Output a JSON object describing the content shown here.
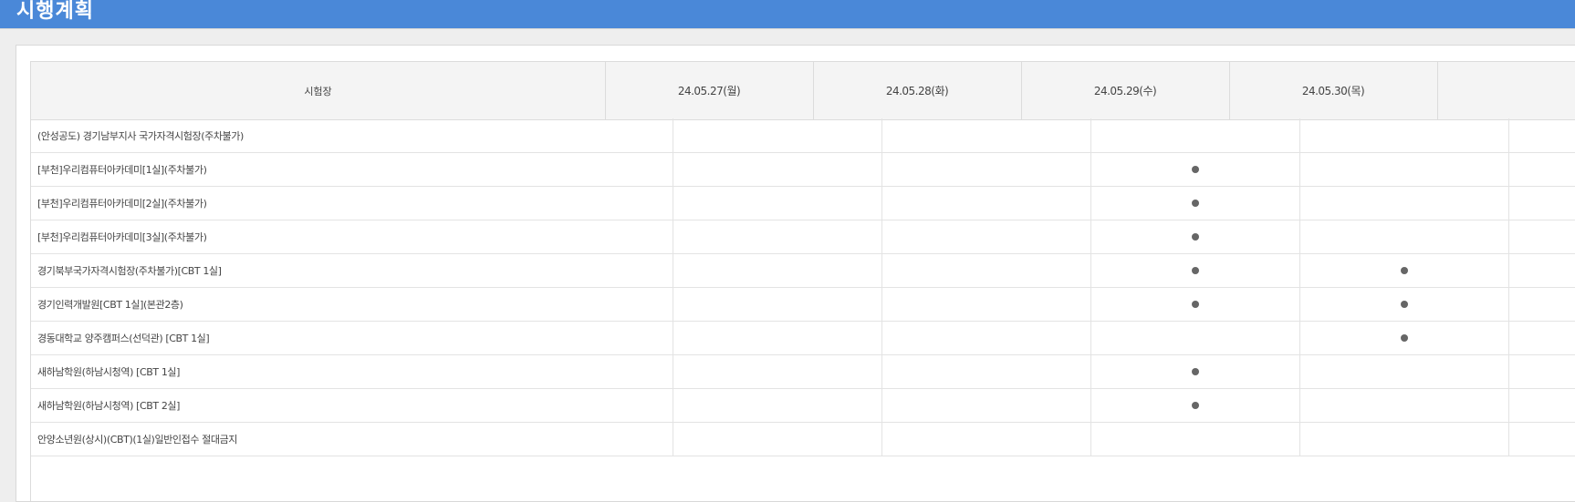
{
  "page": {
    "title": "시행계획"
  },
  "table": {
    "header": {
      "site_label": "시험장",
      "dates": [
        "24.05.27(월)",
        "24.05.28(화)",
        "24.05.29(수)",
        "24.05.30(목)"
      ]
    },
    "rows": [
      {
        "name": "(안성공도) 경기남부지사 국가자격시험장(주차불가)",
        "marks": [
          false,
          false,
          false,
          false
        ]
      },
      {
        "name": "[부천]우리컴퓨터아카데미[1실](주차불가)",
        "marks": [
          false,
          false,
          true,
          false
        ]
      },
      {
        "name": "[부천]우리컴퓨터아카데미[2실](주차불가)",
        "marks": [
          false,
          false,
          true,
          false
        ]
      },
      {
        "name": "[부천]우리컴퓨터아카데미[3실](주차불가)",
        "marks": [
          false,
          false,
          true,
          false
        ]
      },
      {
        "name": "경기북부국가자격시험장(주차불가)[CBT 1실]",
        "marks": [
          false,
          false,
          true,
          true
        ]
      },
      {
        "name": "경기인력개발원[CBT 1실](본관2층)",
        "marks": [
          false,
          false,
          true,
          true
        ]
      },
      {
        "name": "경동대학교 양주캠퍼스(선덕관) [CBT 1실]",
        "marks": [
          false,
          false,
          false,
          true
        ]
      },
      {
        "name": "새하남학원(하남시청역) [CBT 1실]",
        "marks": [
          false,
          false,
          true,
          false
        ]
      },
      {
        "name": "새하남학원(하남시청역) [CBT 2실]",
        "marks": [
          false,
          false,
          true,
          false
        ]
      },
      {
        "name": "안양소년원(상시)(CBT)(1실)일반인접수 절대금지",
        "marks": [
          false,
          false,
          false,
          false
        ]
      }
    ]
  },
  "colors": {
    "accent": "#4a88d8",
    "dot": "#666666"
  },
  "icons": {
    "mark": "filled-circle"
  }
}
